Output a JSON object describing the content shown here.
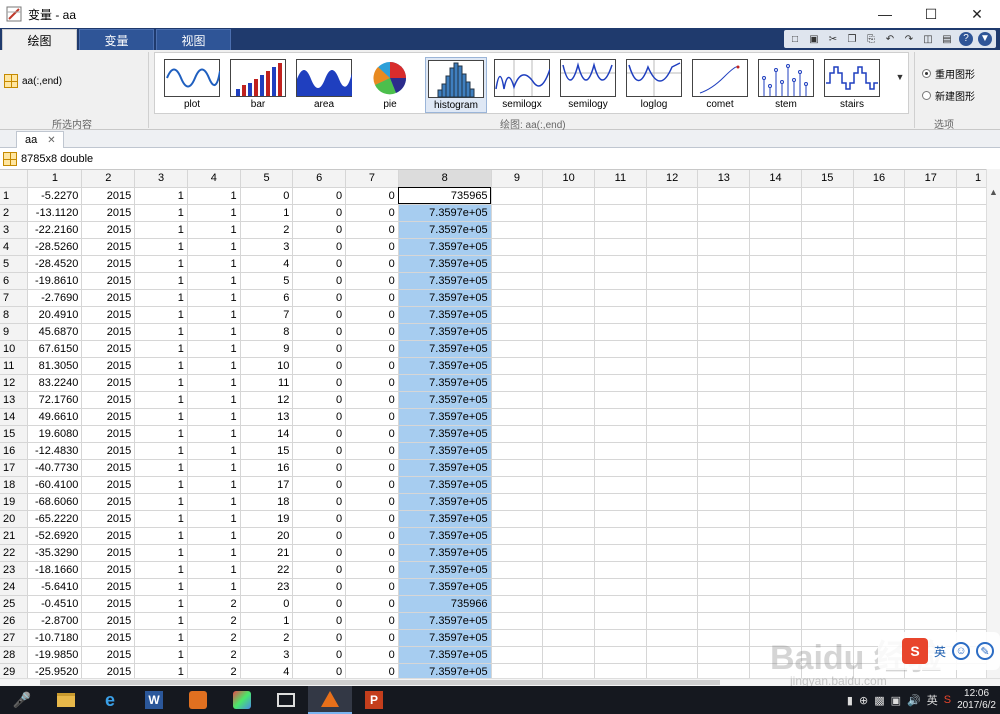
{
  "window": {
    "title": "变量 - aa"
  },
  "tabs": [
    {
      "label": "绘图",
      "active": true
    },
    {
      "label": "变量",
      "active": false
    },
    {
      "label": "视图",
      "active": false
    }
  ],
  "ribbon": {
    "selection_text": "aa(:,end)",
    "group_selection_label": "所选内容",
    "group_plots_label": "绘图: aa(:,end)",
    "group_options_label": "选项",
    "plots": [
      {
        "label": "plot",
        "icon": "plot-icon",
        "selected": false
      },
      {
        "label": "bar",
        "icon": "bar-icon",
        "selected": false
      },
      {
        "label": "area",
        "icon": "area-icon",
        "selected": false
      },
      {
        "label": "pie",
        "icon": "pie-icon",
        "selected": false
      },
      {
        "label": "histogram",
        "icon": "histogram-icon",
        "selected": true
      },
      {
        "label": "semilogx",
        "icon": "semilogx-icon",
        "selected": false
      },
      {
        "label": "semilogy",
        "icon": "semilogy-icon",
        "selected": false
      },
      {
        "label": "loglog",
        "icon": "loglog-icon",
        "selected": false
      },
      {
        "label": "comet",
        "icon": "comet-icon",
        "selected": false
      },
      {
        "label": "stem",
        "icon": "stem-icon",
        "selected": false
      },
      {
        "label": "stairs",
        "icon": "stairs-icon",
        "selected": false
      }
    ],
    "options": [
      {
        "label": "重用图形",
        "selected": true
      },
      {
        "label": "新建图形",
        "selected": false
      }
    ]
  },
  "doc_tab": {
    "label": "aa"
  },
  "variable_info": "8785x8 double",
  "columns": [
    "1",
    "2",
    "3",
    "4",
    "5",
    "6",
    "7",
    "8",
    "9",
    "10",
    "11",
    "12",
    "13",
    "14",
    "15",
    "16",
    "17",
    "1"
  ],
  "rows": [
    {
      "n": "1",
      "c": [
        "-5.2270",
        "2015",
        "1",
        "1",
        "0",
        "0",
        "0",
        "735965"
      ]
    },
    {
      "n": "2",
      "c": [
        "-13.1120",
        "2015",
        "1",
        "1",
        "1",
        "0",
        "0",
        "7.3597e+05"
      ]
    },
    {
      "n": "3",
      "c": [
        "-22.2160",
        "2015",
        "1",
        "1",
        "2",
        "0",
        "0",
        "7.3597e+05"
      ]
    },
    {
      "n": "4",
      "c": [
        "-28.5260",
        "2015",
        "1",
        "1",
        "3",
        "0",
        "0",
        "7.3597e+05"
      ]
    },
    {
      "n": "5",
      "c": [
        "-28.4520",
        "2015",
        "1",
        "1",
        "4",
        "0",
        "0",
        "7.3597e+05"
      ]
    },
    {
      "n": "6",
      "c": [
        "-19.8610",
        "2015",
        "1",
        "1",
        "5",
        "0",
        "0",
        "7.3597e+05"
      ]
    },
    {
      "n": "7",
      "c": [
        "-2.7690",
        "2015",
        "1",
        "1",
        "6",
        "0",
        "0",
        "7.3597e+05"
      ]
    },
    {
      "n": "8",
      "c": [
        "20.4910",
        "2015",
        "1",
        "1",
        "7",
        "0",
        "0",
        "7.3597e+05"
      ]
    },
    {
      "n": "9",
      "c": [
        "45.6870",
        "2015",
        "1",
        "1",
        "8",
        "0",
        "0",
        "7.3597e+05"
      ]
    },
    {
      "n": "10",
      "c": [
        "67.6150",
        "2015",
        "1",
        "1",
        "9",
        "0",
        "0",
        "7.3597e+05"
      ]
    },
    {
      "n": "11",
      "c": [
        "81.3050",
        "2015",
        "1",
        "1",
        "10",
        "0",
        "0",
        "7.3597e+05"
      ]
    },
    {
      "n": "12",
      "c": [
        "83.2240",
        "2015",
        "1",
        "1",
        "11",
        "0",
        "0",
        "7.3597e+05"
      ]
    },
    {
      "n": "13",
      "c": [
        "72.1760",
        "2015",
        "1",
        "1",
        "12",
        "0",
        "0",
        "7.3597e+05"
      ]
    },
    {
      "n": "14",
      "c": [
        "49.6610",
        "2015",
        "1",
        "1",
        "13",
        "0",
        "0",
        "7.3597e+05"
      ]
    },
    {
      "n": "15",
      "c": [
        "19.6080",
        "2015",
        "1",
        "1",
        "14",
        "0",
        "0",
        "7.3597e+05"
      ]
    },
    {
      "n": "16",
      "c": [
        "-12.4830",
        "2015",
        "1",
        "1",
        "15",
        "0",
        "0",
        "7.3597e+05"
      ]
    },
    {
      "n": "17",
      "c": [
        "-40.7730",
        "2015",
        "1",
        "1",
        "16",
        "0",
        "0",
        "7.3597e+05"
      ]
    },
    {
      "n": "18",
      "c": [
        "-60.4100",
        "2015",
        "1",
        "1",
        "17",
        "0",
        "0",
        "7.3597e+05"
      ]
    },
    {
      "n": "19",
      "c": [
        "-68.6060",
        "2015",
        "1",
        "1",
        "18",
        "0",
        "0",
        "7.3597e+05"
      ]
    },
    {
      "n": "20",
      "c": [
        "-65.2220",
        "2015",
        "1",
        "1",
        "19",
        "0",
        "0",
        "7.3597e+05"
      ]
    },
    {
      "n": "21",
      "c": [
        "-52.6920",
        "2015",
        "1",
        "1",
        "20",
        "0",
        "0",
        "7.3597e+05"
      ]
    },
    {
      "n": "22",
      "c": [
        "-35.3290",
        "2015",
        "1",
        "1",
        "21",
        "0",
        "0",
        "7.3597e+05"
      ]
    },
    {
      "n": "23",
      "c": [
        "-18.1660",
        "2015",
        "1",
        "1",
        "22",
        "0",
        "0",
        "7.3597e+05"
      ]
    },
    {
      "n": "24",
      "c": [
        "-5.6410",
        "2015",
        "1",
        "1",
        "23",
        "0",
        "0",
        "7.3597e+05"
      ]
    },
    {
      "n": "25",
      "c": [
        "-0.4510",
        "2015",
        "1",
        "2",
        "0",
        "0",
        "0",
        "735966"
      ]
    },
    {
      "n": "26",
      "c": [
        "-2.8700",
        "2015",
        "1",
        "2",
        "1",
        "0",
        "0",
        "7.3597e+05"
      ]
    },
    {
      "n": "27",
      "c": [
        "-10.7180",
        "2015",
        "1",
        "2",
        "2",
        "0",
        "0",
        "7.3597e+05"
      ]
    },
    {
      "n": "28",
      "c": [
        "-19.9850",
        "2015",
        "1",
        "2",
        "3",
        "0",
        "0",
        "7.3597e+05"
      ]
    },
    {
      "n": "29",
      "c": [
        "-25.9520",
        "2015",
        "1",
        "2",
        "4",
        "0",
        "0",
        "7.3597e+05"
      ]
    }
  ],
  "taskbar": {
    "items": [
      "mic-icon",
      "file-explorer-icon",
      "ie-icon",
      "word-icon",
      "app-icon",
      "paint-icon",
      "photos-icon",
      "matlab-icon",
      "powerpoint-icon"
    ],
    "ime": "英",
    "time": "12:06",
    "date": "2017/6/2"
  },
  "watermark": {
    "text": "Baidu 经验",
    "sub": "jingyan.baidu.com"
  },
  "side_widget": {
    "ime_label": "S",
    "text": "英"
  }
}
